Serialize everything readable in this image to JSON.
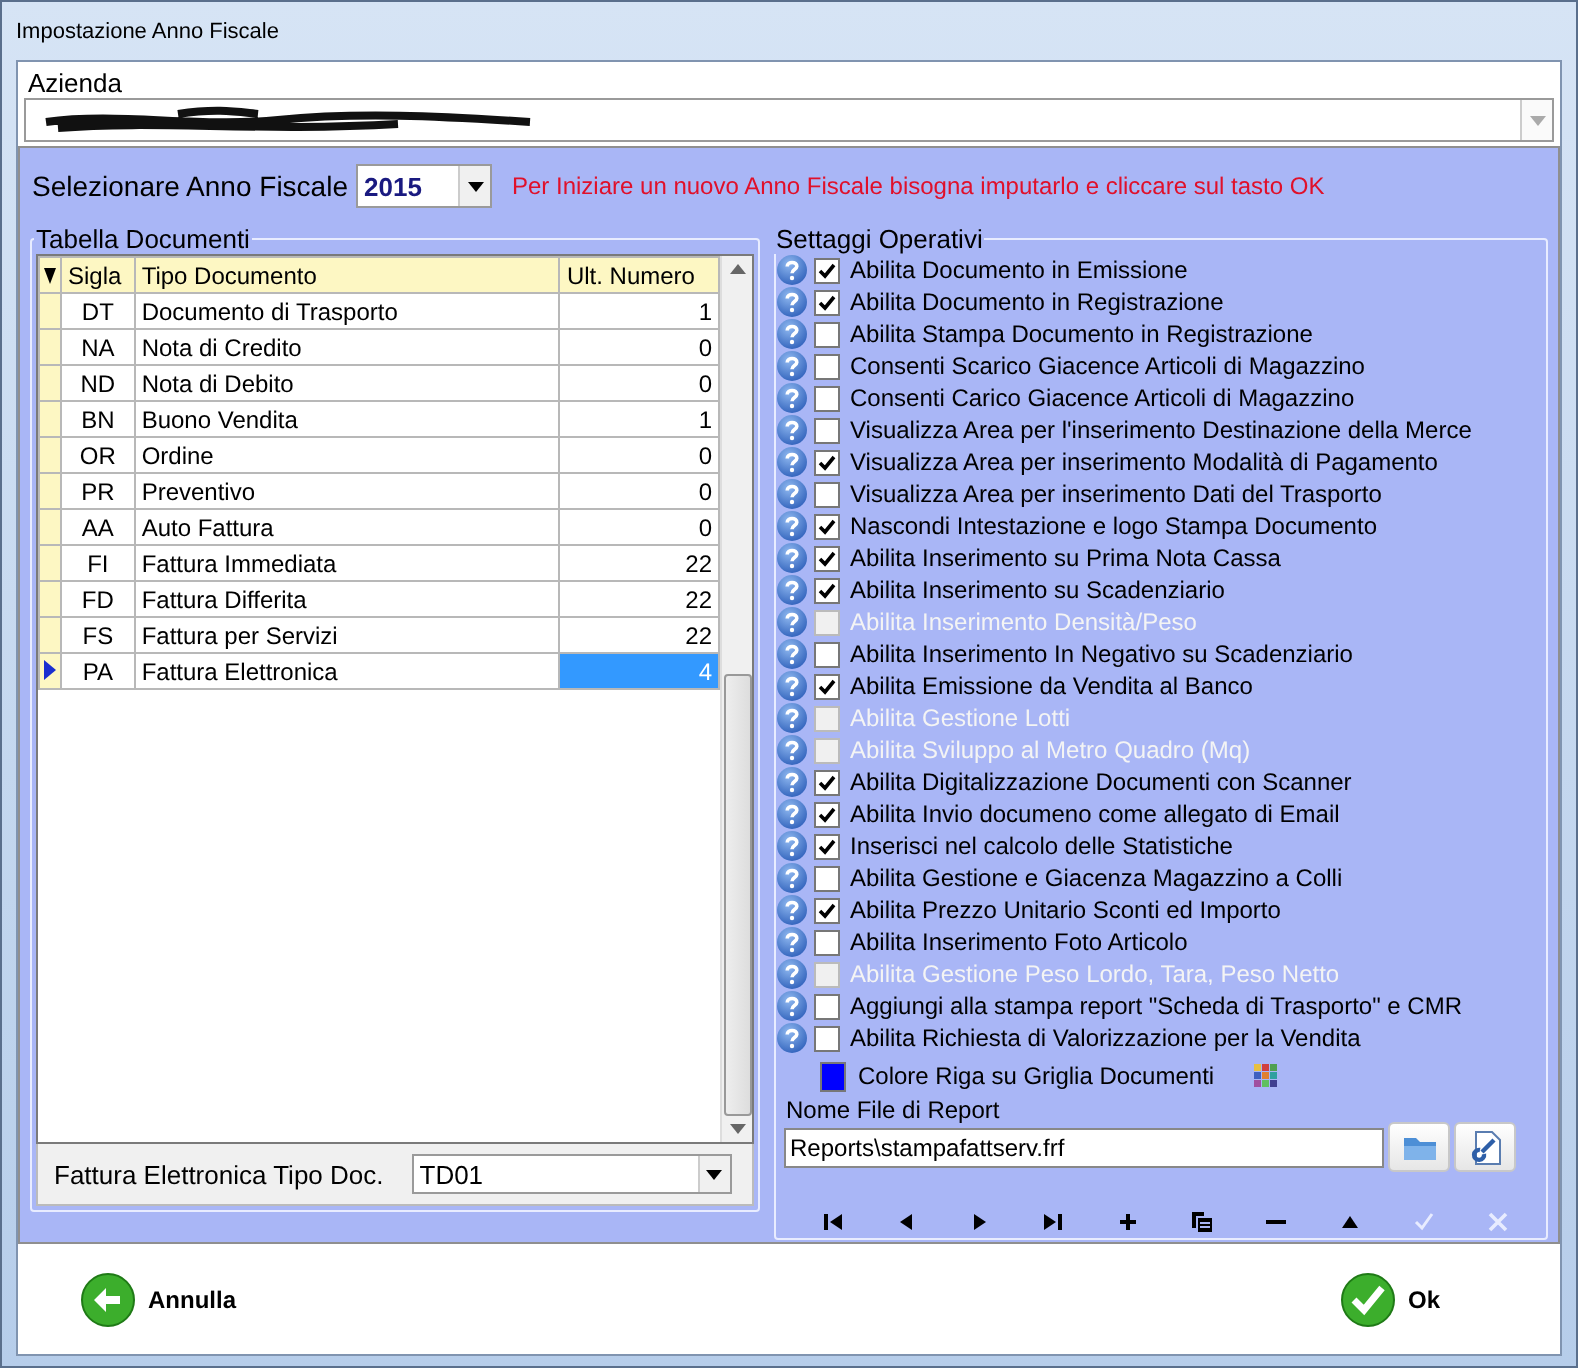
{
  "window": {
    "title": "Impostazione Anno Fiscale"
  },
  "company": {
    "label": "Azienda"
  },
  "fiscal_year": {
    "label": "Selezionare Anno Fiscale",
    "value": "2015",
    "hint": "Per Iniziare un nuovo Anno Fiscale bisogna imputarlo e cliccare sul tasto OK"
  },
  "documents": {
    "title": "Tabella Documenti",
    "columns": [
      "Sigla",
      "Tipo Documento",
      "Ult. Numero"
    ],
    "rows": [
      {
        "code": "DT",
        "type": "Documento di Trasporto",
        "last_number": "1",
        "selected": false
      },
      {
        "code": "NA",
        "type": "Nota di Credito",
        "last_number": "0",
        "selected": false
      },
      {
        "code": "ND",
        "type": "Nota di Debito",
        "last_number": "0",
        "selected": false
      },
      {
        "code": "BN",
        "type": "Buono Vendita",
        "last_number": "1",
        "selected": false
      },
      {
        "code": "OR",
        "type": "Ordine",
        "last_number": "0",
        "selected": false
      },
      {
        "code": "PR",
        "type": "Preventivo",
        "last_number": "0",
        "selected": false
      },
      {
        "code": "AA",
        "type": "Auto Fattura",
        "last_number": "0",
        "selected": false
      },
      {
        "code": "FI",
        "type": "Fattura Immediata",
        "last_number": "22",
        "selected": false
      },
      {
        "code": "FD",
        "type": "Fattura Differita",
        "last_number": "22",
        "selected": false
      },
      {
        "code": "FS",
        "type": "Fattura per Servizi",
        "last_number": "22",
        "selected": false
      },
      {
        "code": "PA",
        "type": "Fattura Elettronica",
        "last_number": "4",
        "selected": true
      }
    ]
  },
  "e_invoice_type": {
    "label": "Fattura Elettronica Tipo Doc.",
    "value": "TD01"
  },
  "settings": {
    "title": "Settaggi Operativi",
    "items": [
      {
        "kind": "check",
        "label": "Abilita Documento in Emissione",
        "checked": true,
        "disabled": false
      },
      {
        "kind": "check",
        "label": "Abilita Documento in Registrazione",
        "checked": true,
        "disabled": false
      },
      {
        "kind": "check",
        "label": "Abilita Stampa Documento in Registrazione",
        "checked": false,
        "disabled": false
      },
      {
        "kind": "check",
        "label": "Consenti Scarico Giacence Articoli di Magazzino",
        "checked": false,
        "disabled": false
      },
      {
        "kind": "check",
        "label": "Consenti Carico Giacence Articoli di Magazzino",
        "checked": false,
        "disabled": false
      },
      {
        "kind": "check",
        "label": "Visualizza Area per l'inserimento Destinazione della Merce",
        "checked": false,
        "disabled": false
      },
      {
        "kind": "check",
        "label": "Visualizza Area per inserimento Modalità di Pagamento",
        "checked": true,
        "disabled": false
      },
      {
        "kind": "check",
        "label": "Visualizza Area per inserimento Dati del Trasporto",
        "checked": false,
        "disabled": false
      },
      {
        "kind": "check",
        "label": "Nascondi Intestazione e logo Stampa Documento",
        "checked": true,
        "disabled": false
      },
      {
        "kind": "check",
        "label": "Abilita Inserimento su Prima Nota Cassa",
        "checked": true,
        "disabled": false
      },
      {
        "kind": "check",
        "label": "Abilita Inserimento su Scadenziario",
        "checked": true,
        "disabled": false
      },
      {
        "kind": "check",
        "label": "Abilita Inserimento Densità/Peso",
        "checked": false,
        "disabled": true
      },
      {
        "kind": "check",
        "label": "Abilita Inserimento In Negativo su Scadenziario",
        "checked": false,
        "disabled": false
      },
      {
        "kind": "check",
        "label": "Abilita Emissione da Vendita al Banco",
        "checked": true,
        "disabled": false
      },
      {
        "kind": "check",
        "label": "Abilita Gestione Lotti",
        "checked": false,
        "disabled": true
      },
      {
        "kind": "check",
        "label": "Abilita Sviluppo al Metro Quadro (Mq)",
        "checked": false,
        "disabled": true
      },
      {
        "kind": "check",
        "label": "Abilita Digitalizzazione Documenti con Scanner",
        "checked": true,
        "disabled": false
      },
      {
        "kind": "check",
        "label": "Abilita Invio documeno come allegato di Email",
        "checked": true,
        "disabled": false
      },
      {
        "kind": "check",
        "label": "Inserisci nel calcolo delle Statistiche",
        "checked": true,
        "disabled": false
      },
      {
        "kind": "check",
        "label": "Abilita Gestione e Giacenza Magazzino a Colli",
        "checked": false,
        "disabled": false
      },
      {
        "kind": "check",
        "label": "Abilita Prezzo Unitario Sconti ed Importo",
        "checked": true,
        "disabled": false
      },
      {
        "kind": "check",
        "label": "Abilita Inserimento Foto Articolo",
        "checked": false,
        "disabled": false
      },
      {
        "kind": "check",
        "label": "Abilita Gestione Peso Lordo, Tara, Peso Netto",
        "checked": false,
        "disabled": true
      },
      {
        "kind": "check",
        "label": "Aggiungi alla stampa report \"Scheda di Trasporto\" e CMR",
        "checked": false,
        "disabled": false
      },
      {
        "kind": "check",
        "label": "Abilita Richiesta di Valorizzazione per la Vendita",
        "checked": false,
        "disabled": false
      },
      {
        "kind": "color",
        "label": "Colore Riga su Griglia Documenti",
        "color": "#0000ff"
      }
    ]
  },
  "report_file": {
    "label": "Nome File di Report",
    "value": "Reports\\stampafattserv.frf"
  },
  "navigator": [
    {
      "kind": "first",
      "disabled": false
    },
    {
      "kind": "prior",
      "disabled": false
    },
    {
      "kind": "next",
      "disabled": false
    },
    {
      "kind": "last",
      "disabled": false
    },
    {
      "kind": "insert",
      "disabled": false
    },
    {
      "kind": "copy",
      "disabled": false
    },
    {
      "kind": "delete",
      "disabled": false
    },
    {
      "kind": "edit",
      "disabled": false
    },
    {
      "kind": "post",
      "disabled": true
    },
    {
      "kind": "cancel",
      "disabled": true
    }
  ],
  "buttons": [
    {
      "kind": "cancel",
      "label": "Annulla"
    },
    {
      "kind": "ok",
      "label": "Ok"
    }
  ]
}
